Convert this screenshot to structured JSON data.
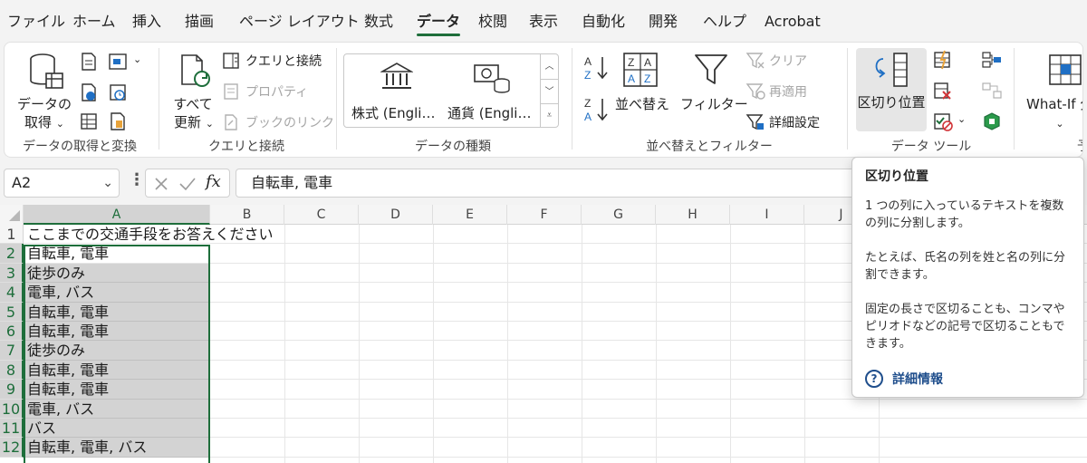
{
  "menu": {
    "tabs": [
      "ファイル",
      "ホーム",
      "挿入",
      "描画",
      "ページ レイアウト",
      "数式",
      "データ",
      "校閲",
      "表示",
      "自動化",
      "開発",
      "ヘルプ",
      "Acrobat"
    ],
    "active": "データ"
  },
  "ribbon": {
    "get_data": {
      "label_line1": "データの",
      "label_line2": "取得",
      "group": "データの取得と変換"
    },
    "queries": {
      "refresh_line1": "すべて",
      "refresh_line2": "更新",
      "queries_connections": "クエリと接続",
      "properties": "プロパティ",
      "edit_links": "ブックのリンク",
      "group": "クエリと接続"
    },
    "data_types": {
      "stocks": "株式 (Engli…",
      "currencies": "通貨 (Engli…",
      "group": "データの種類"
    },
    "sort_filter": {
      "sort": "並べ替え",
      "filter": "フィルター",
      "clear": "クリア",
      "reapply": "再適用",
      "advanced": "詳細設定",
      "group": "並べ替えとフィルター"
    },
    "data_tools": {
      "text_to_columns": "区切り位置",
      "group": "データ ツール"
    },
    "forecast": {
      "what_if_line1": "What-If 分",
      "group_partial": "予"
    }
  },
  "formula_bar": {
    "name_box": "A2",
    "fx": "fx",
    "formula": "自転車, 電車"
  },
  "grid": {
    "columns": [
      "A",
      "B",
      "C",
      "D",
      "E",
      "F",
      "G",
      "H",
      "I",
      "J"
    ],
    "rows": [
      {
        "n": "1",
        "a": "ここまでの交通手段をお答えください"
      },
      {
        "n": "2",
        "a": "自転車, 電車"
      },
      {
        "n": "3",
        "a": "徒歩のみ"
      },
      {
        "n": "4",
        "a": "電車, バス"
      },
      {
        "n": "5",
        "a": "自転車, 電車"
      },
      {
        "n": "6",
        "a": "自転車, 電車"
      },
      {
        "n": "7",
        "a": "徒歩のみ"
      },
      {
        "n": "8",
        "a": "自転車, 電車"
      },
      {
        "n": "9",
        "a": "自転車, 電車"
      },
      {
        "n": "10",
        "a": "電車, バス"
      },
      {
        "n": "11",
        "a": "バス"
      },
      {
        "n": "12",
        "a": "自転車, 電車, バス"
      }
    ]
  },
  "tooltip": {
    "title": "区切り位置",
    "p1": "1 つの列に入っているテキストを複数の列に分割します。",
    "p2": "たとえば、氏名の列を姓と名の列に分割できます。",
    "p3": "固定の長さで区切ることも、コンマやピリオドなどの記号で区切ることもできます。",
    "more": "詳細情報"
  },
  "colors": {
    "accent": "#1e6e3b",
    "selection": "#d3d3d3",
    "link": "#1f4e8c"
  }
}
